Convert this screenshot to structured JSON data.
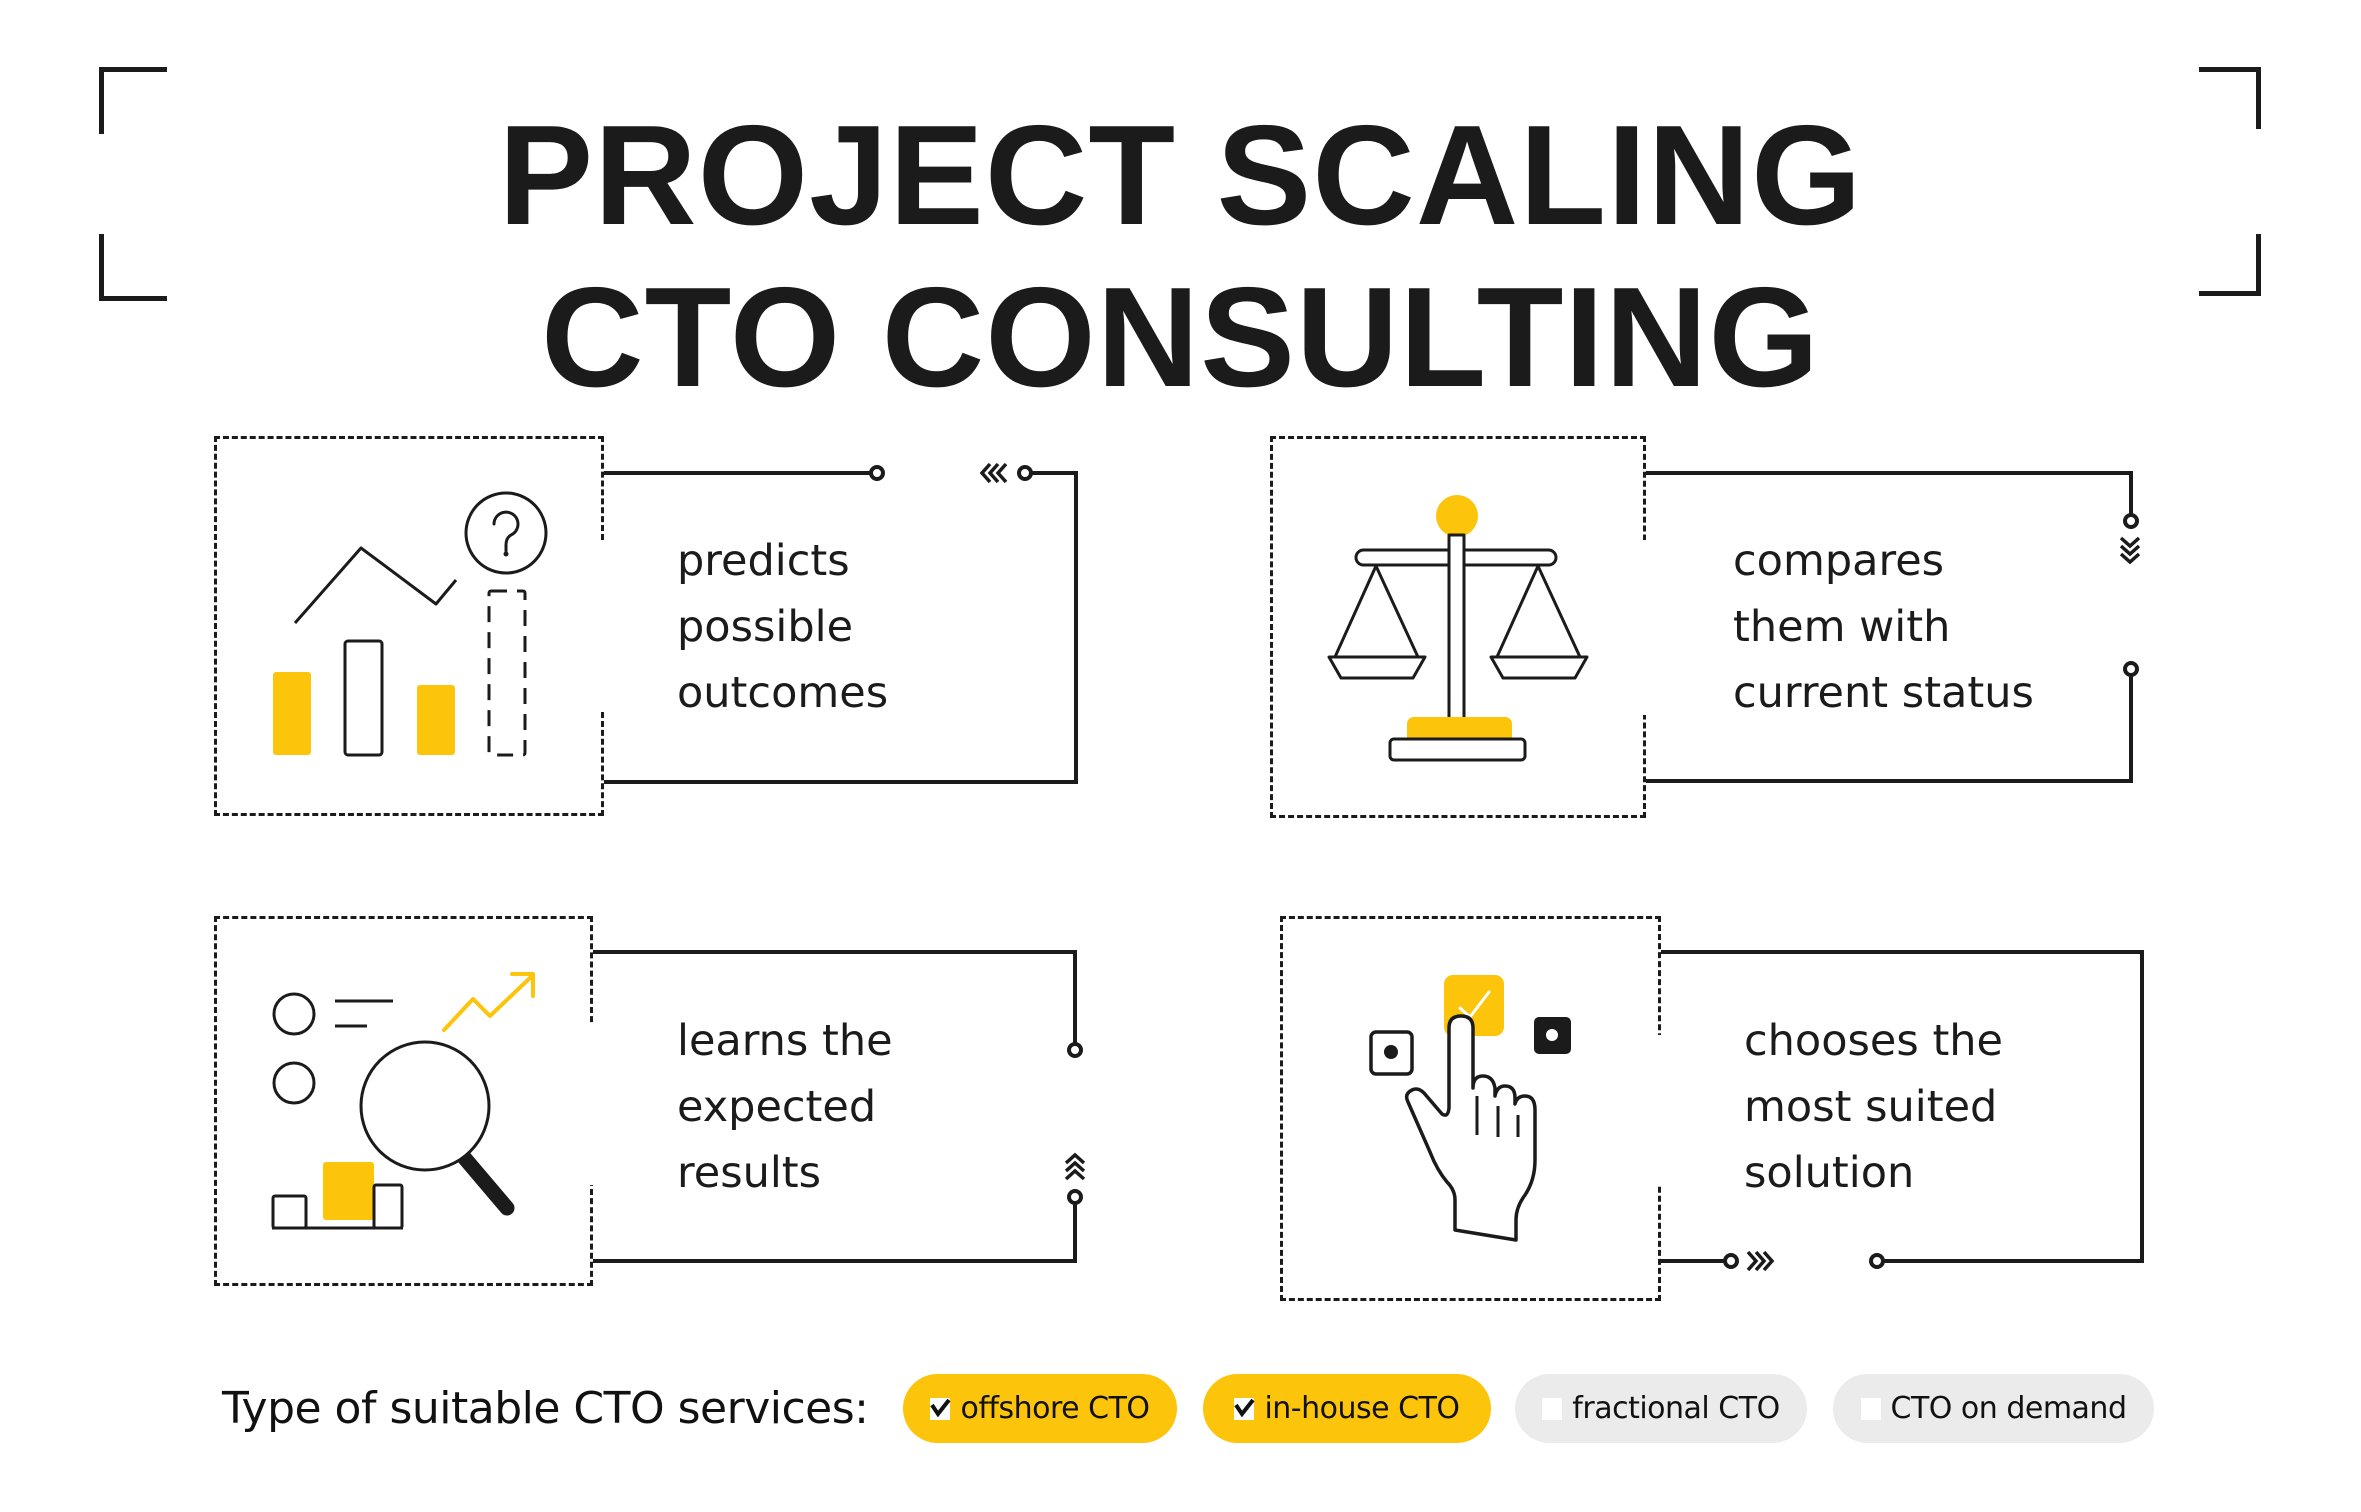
{
  "title": {
    "line1": "PROJECT SCALING",
    "line2": "CTO CONSULTING"
  },
  "cards": [
    {
      "id": "predict",
      "icon": "bar-chart-question-icon",
      "lines": [
        "predicts",
        "possible",
        "outcomes"
      ]
    },
    {
      "id": "compare",
      "icon": "balance-scale-icon",
      "lines": [
        "compares",
        "them with",
        "current status"
      ]
    },
    {
      "id": "learn",
      "icon": "magnifier-analytics-icon",
      "lines": [
        "learns the",
        "expected",
        "results"
      ]
    },
    {
      "id": "choose",
      "icon": "hand-pointer-choice-icon",
      "lines": [
        "chooses the",
        "most suited",
        "solution"
      ]
    }
  ],
  "services": {
    "label": "Type of suitable CTO services:",
    "options": [
      {
        "label": "offshore CTO",
        "checked": true
      },
      {
        "label": "in-house CTO",
        "checked": true
      },
      {
        "label": "fractional CTO",
        "checked": false
      },
      {
        "label": "CTO on demand",
        "checked": false
      }
    ]
  },
  "colors": {
    "accent": "#FCC40A",
    "ink": "#1B1B1B",
    "pill_inactive": "#EBEBEB",
    "background": "#FFFFFF"
  }
}
